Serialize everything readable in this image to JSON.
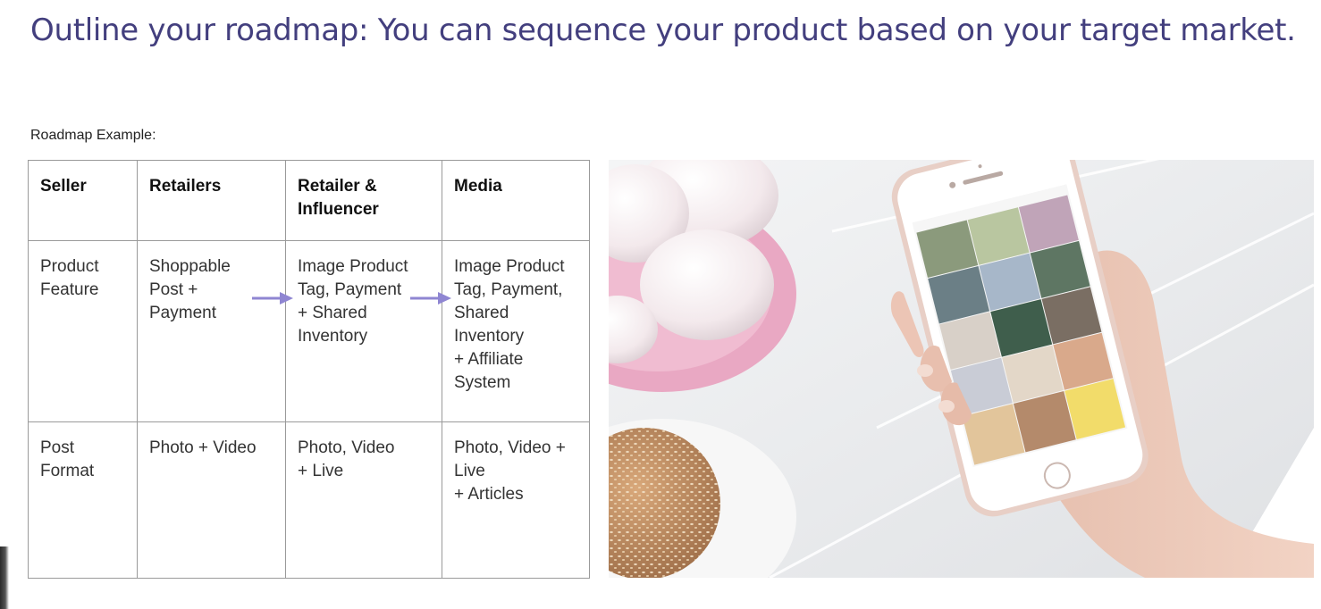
{
  "slide": {
    "title": "Outline your roadmap: You can sequence your product based on your target market."
  },
  "roadmap": {
    "caption": "Roadmap Example:",
    "headers": [
      "Seller",
      "Retailers",
      "Retailer &\nInfluencer",
      "Media"
    ],
    "rows": [
      {
        "label": "Product\nFeature",
        "cells": [
          "Shoppable\nPost +\nPayment",
          "Image Product\nTag, Payment\n+ Shared\nInventory",
          "Image Product\nTag, Payment,\nShared\nInventory\n+ Affiliate\nSystem"
        ]
      },
      {
        "label": "Post\nFormat",
        "cells": [
          "Photo + Video",
          "Photo, Video\n+ Live",
          "Photo, Video +\nLive\n+ Articles"
        ]
      }
    ],
    "arrow_color": "#8f86d2"
  },
  "colors": {
    "title": "#433f7e",
    "border": "#9a9a9a",
    "plate_pink": "#e9a8c3",
    "phone_rose_gold": "#e8cfc6"
  },
  "icons": {
    "arrow": "right-arrow-icon",
    "home": "home-button-icon"
  }
}
